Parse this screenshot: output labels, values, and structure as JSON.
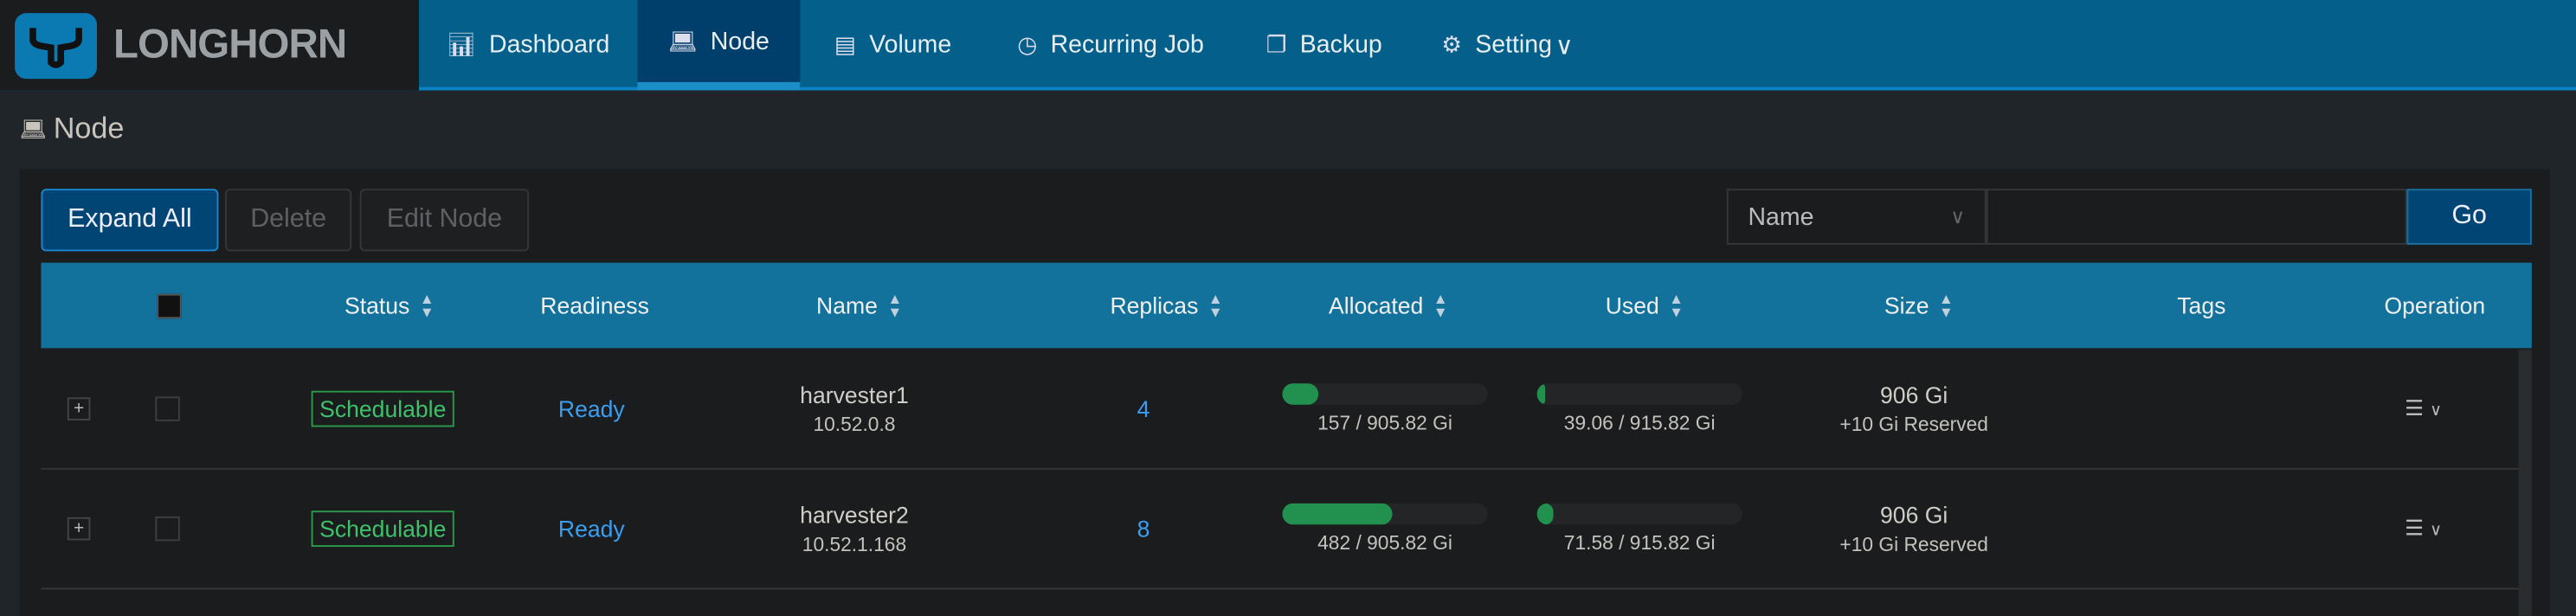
{
  "brand": "LONGHORN",
  "nav": [
    {
      "label": "Dashboard",
      "icon": "chart-icon"
    },
    {
      "label": "Node",
      "icon": "laptop-icon",
      "active": true
    },
    {
      "label": "Volume",
      "icon": "server-icon"
    },
    {
      "label": "Recurring Job",
      "icon": "clock-icon"
    },
    {
      "label": "Backup",
      "icon": "copy-icon"
    },
    {
      "label": "Setting",
      "icon": "gear-icon"
    }
  ],
  "page_title": "Node",
  "toolbar": {
    "expand_all": "Expand All",
    "delete": "Delete",
    "edit_node": "Edit Node"
  },
  "search": {
    "field": "Name",
    "value": "",
    "go": "Go"
  },
  "columns": {
    "status": "Status",
    "readiness": "Readiness",
    "name": "Name",
    "replicas": "Replicas",
    "allocated": "Allocated",
    "used": "Used",
    "size": "Size",
    "tags": "Tags",
    "operation": "Operation"
  },
  "rows": [
    {
      "status": "Schedulable",
      "readiness": "Ready",
      "name": "harvester1",
      "ip": "10.52.0.8",
      "replicas": "4",
      "allocated": "157 / 905.82 Gi",
      "allocated_pct": 17.3,
      "used": "39.06 / 915.82 Gi",
      "used_pct": 4.3,
      "size": "906 Gi",
      "reserved": "+10 Gi Reserved"
    },
    {
      "status": "Schedulable",
      "readiness": "Ready",
      "name": "harvester2",
      "ip": "10.52.1.168",
      "replicas": "8",
      "allocated": "482 / 905.82 Gi",
      "allocated_pct": 53.2,
      "used": "71.58 / 915.82 Gi",
      "used_pct": 7.8,
      "size": "906 Gi",
      "reserved": "+10 Gi Reserved"
    }
  ]
}
